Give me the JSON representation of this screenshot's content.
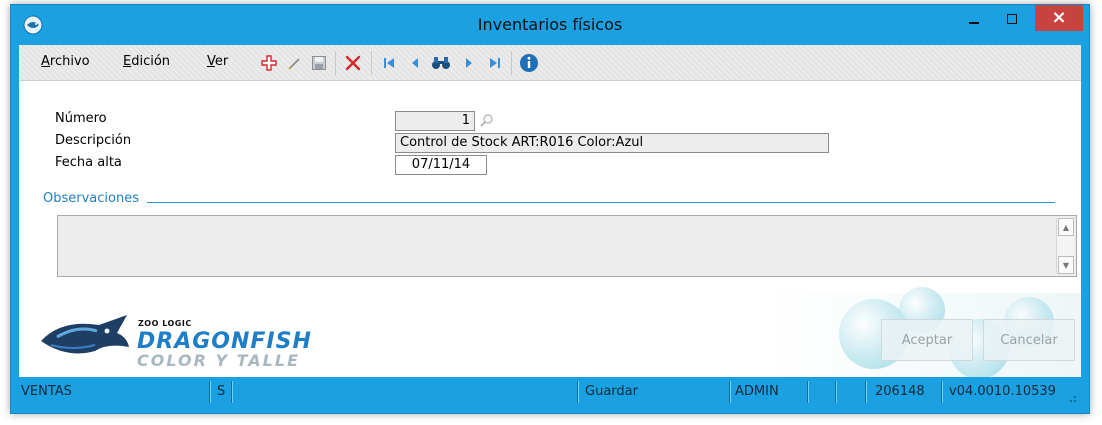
{
  "window": {
    "title": "Inventarios físicos",
    "close_glyph": "×"
  },
  "menu": {
    "archivo_accel": "A",
    "archivo_rest": "rchivo",
    "edicion_accel": "E",
    "edicion_rest": "dición",
    "ver_accel": "V",
    "ver_rest": "er"
  },
  "toolbar": {
    "icons": [
      "add-icon",
      "edit-icon",
      "save-icon",
      "delete-icon",
      "first-record-icon",
      "previous-record-icon",
      "search-binoculars-icon",
      "next-record-icon",
      "last-record-icon",
      "info-icon"
    ]
  },
  "form": {
    "numero_label": "Número",
    "numero_value": "1",
    "descripcion_label": "Descripción",
    "descripcion_value": "Control de Stock ART:R016 Color:Azul",
    "fecha_label": "Fecha alta",
    "fecha_value": "07/11/14",
    "observaciones_label": "Observaciones",
    "observaciones_value": ""
  },
  "logo": {
    "small": "ZOO LOGIC",
    "main": "DRAGONFISH",
    "sub": "COLOR Y TALLE"
  },
  "buttons": {
    "aceptar": "Aceptar",
    "cancelar": "Cancelar"
  },
  "status": {
    "module": "VENTAS",
    "flag": "S",
    "action": "Guardar",
    "user": "ADMIN",
    "code": "206148",
    "version": "v04.0010.10539"
  },
  "colors": {
    "accent": "#1ba1e2",
    "close": "#c7433d",
    "delete": "#d9262b",
    "nav": "#3b8fd6"
  }
}
